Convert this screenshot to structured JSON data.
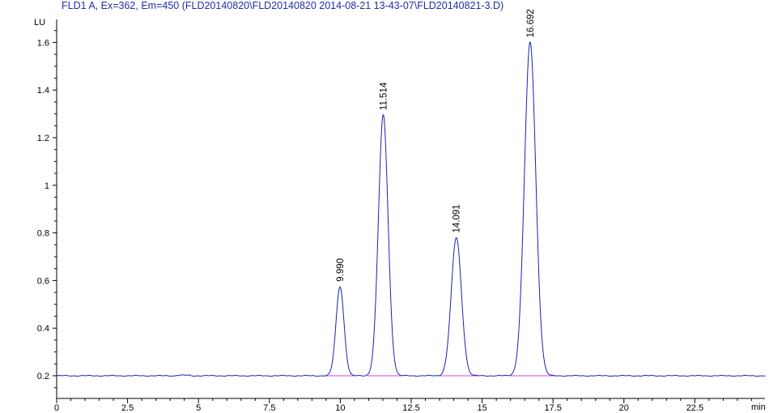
{
  "header": {
    "title": "FLD1 A, Ex=362, Em=450 (FLD20140820\\FLD20140820 2014-08-21 13-43-07\\FLD20140821-3.D)"
  },
  "colors": {
    "trace": "#1a22b4",
    "baseline": "#e040e0",
    "axis": "#000000",
    "title": "#1f2ea8"
  },
  "chart_data": {
    "type": "line",
    "title": "FLD1 A, Ex=362, Em=450 (FLD20140820\\FLD20140820 2014-08-21 13-43-07\\FLD20140821-3.D)",
    "xlabel": "min",
    "ylabel": "LU",
    "xlim": [
      0,
      25
    ],
    "ylim": [
      0.1,
      1.65
    ],
    "x_ticks": [
      "0",
      "2.5",
      "5",
      "7.5",
      "10",
      "12.5",
      "15",
      "17.5",
      "20",
      "22.5"
    ],
    "y_ticks": [
      "0.2",
      "0.4",
      "0.6",
      "0.8",
      "1",
      "1.2",
      "1.4",
      "1.6"
    ],
    "x_tick_values": [
      0,
      2.5,
      5,
      7.5,
      10,
      12.5,
      15,
      17.5,
      20,
      22.5
    ],
    "y_tick_values": [
      0.2,
      0.4,
      0.6,
      0.8,
      1.0,
      1.2,
      1.4,
      1.6
    ],
    "baseline_level": 0.2,
    "grid": false,
    "peaks": [
      {
        "rt": 9.99,
        "label": "9.990",
        "height": 0.575,
        "width": 0.14
      },
      {
        "rt": 11.514,
        "label": "11.514",
        "height": 1.295,
        "width": 0.17
      },
      {
        "rt": 14.091,
        "label": "14.091",
        "height": 0.78,
        "width": 0.18
      },
      {
        "rt": 16.692,
        "label": "16.692",
        "height": 1.6,
        "width": 0.2
      }
    ],
    "baseline_segments": [
      {
        "from": 9.4,
        "to": 10.6
      },
      {
        "from": 10.95,
        "to": 12.2
      },
      {
        "from": 13.4,
        "to": 14.9
      },
      {
        "from": 16.0,
        "to": 17.6
      }
    ]
  }
}
